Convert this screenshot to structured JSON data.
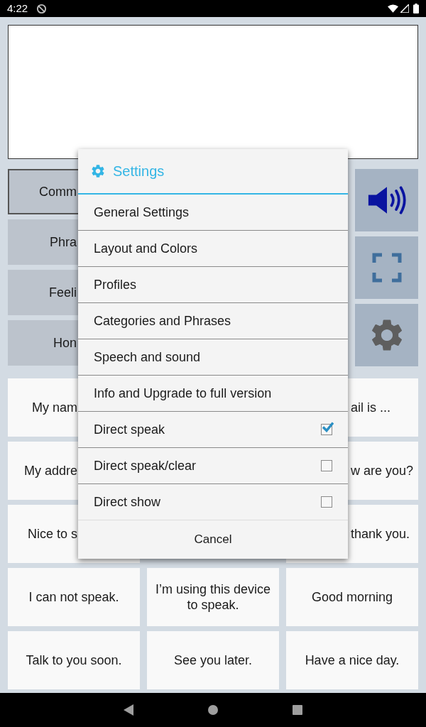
{
  "status_bar": {
    "time": "4:22"
  },
  "categories": [
    {
      "label": "Comm",
      "selected": true
    },
    {
      "label": "Phra",
      "selected": false
    },
    {
      "label": "Feeli",
      "selected": false
    },
    {
      "label": "Hon",
      "selected": false
    }
  ],
  "phrases": [
    {
      "left": "My nam",
      "right": "ail is ..."
    },
    {
      "left": "My addre",
      "right": "w are you?"
    },
    {
      "left": "Nice to s",
      "right": "thank you."
    },
    {
      "left": "I can not speak.",
      "middle": "I’m using this device to speak.",
      "right": "Good morning"
    },
    {
      "left": "Talk to you soon.",
      "middle": "See you later.",
      "right": "Have a nice day."
    }
  ],
  "dialog": {
    "title": "Settings",
    "items": [
      {
        "kind": "link",
        "label": "General Settings"
      },
      {
        "kind": "link",
        "label": "Layout and Colors"
      },
      {
        "kind": "link",
        "label": "Profiles"
      },
      {
        "kind": "link",
        "label": "Categories and Phrases"
      },
      {
        "kind": "link",
        "label": "Speech and sound"
      },
      {
        "kind": "link",
        "label": "Info and Upgrade to full version"
      },
      {
        "kind": "checkbox",
        "label": "Direct speak",
        "checked": true
      },
      {
        "kind": "checkbox",
        "label": "Direct speak/clear",
        "checked": false
      },
      {
        "kind": "checkbox",
        "label": "Direct show",
        "checked": false
      }
    ],
    "cancel": "Cancel"
  }
}
